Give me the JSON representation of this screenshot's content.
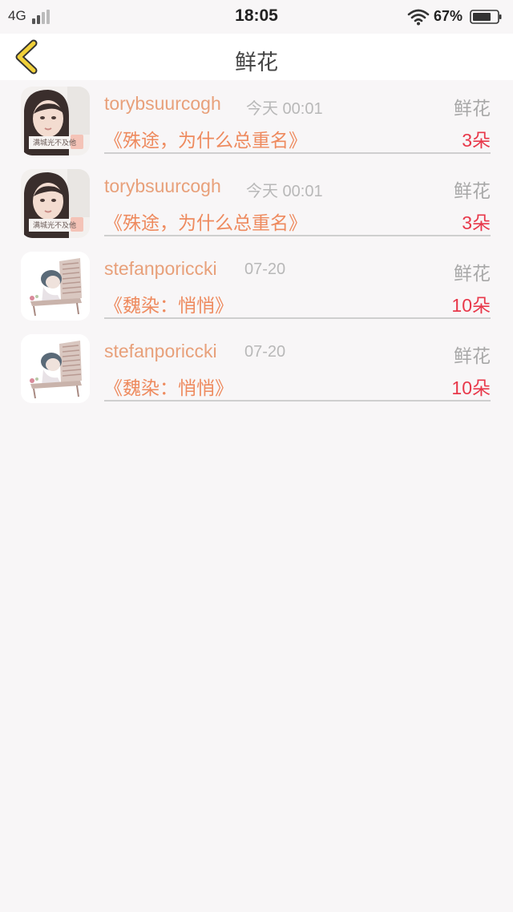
{
  "status_bar": {
    "network": "4G",
    "time": "18:05",
    "battery_percent": "67%"
  },
  "header": {
    "title": "鲜花",
    "back_icon": "chevron-left-icon"
  },
  "records": [
    {
      "user": "torybsuurcogh",
      "time": "今天 00:01",
      "type": "鲜花",
      "book": "《殊途，为什么总重名》",
      "count": "3朵",
      "avatar_caption": "满城光不及他"
    },
    {
      "user": "torybsuurcogh",
      "time": "今天 00:01",
      "type": "鲜花",
      "book": "《殊途，为什么总重名》",
      "count": "3朵",
      "avatar_caption": "满城光不及他"
    },
    {
      "user": "stefanporiccki",
      "time": "07-20",
      "type": "鲜花",
      "book": "《魏染：悄悄》",
      "count": "10朵",
      "avatar_caption": ""
    },
    {
      "user": "stefanporiccki",
      "time": "07-20",
      "type": "鲜花",
      "book": "《魏染：悄悄》",
      "count": "10朵",
      "avatar_caption": ""
    }
  ],
  "colors": {
    "accent_name": "#e8a07a",
    "accent_title": "#ee8a5e",
    "count_red": "#e8384a",
    "back_yellow": "#f0d03a"
  }
}
